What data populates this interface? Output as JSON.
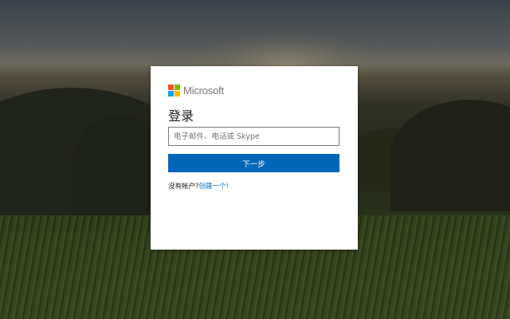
{
  "brand": {
    "name": "Microsoft",
    "logo_colors": [
      "#f25022",
      "#7fba00",
      "#00a4ef",
      "#ffb900"
    ]
  },
  "login": {
    "title": "登录",
    "email_placeholder": "电子邮件、电话或 Skype",
    "email_value": "",
    "next_label": "下一步",
    "no_account_text": "没有帐户?",
    "create_link": "创建一个!"
  },
  "colors": {
    "accent": "#0067b8",
    "card_background": "#ffffff"
  }
}
